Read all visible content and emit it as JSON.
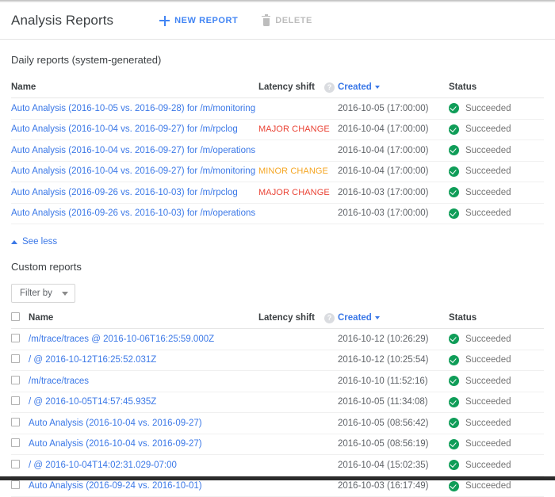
{
  "header": {
    "title": "Analysis Reports",
    "new_report_label": "NEW REPORT",
    "delete_label": "DELETE"
  },
  "daily": {
    "section_title": "Daily reports (system-generated)",
    "columns": {
      "name": "Name",
      "latency_shift": "Latency shift",
      "created": "Created",
      "status": "Status",
      "help_glyph": "?"
    },
    "rows": [
      {
        "name": "Auto Analysis (2016-10-05 vs. 2016-09-28) for /m/monitoring",
        "latency": "",
        "latency_level": "",
        "created": "2016-10-05 (17:00:00)",
        "status": "Succeeded"
      },
      {
        "name": "Auto Analysis (2016-10-04 vs. 2016-09-27) for /m/rpclog",
        "latency": "MAJOR CHANGE",
        "latency_level": "major",
        "created": "2016-10-04 (17:00:00)",
        "status": "Succeeded"
      },
      {
        "name": "Auto Analysis (2016-10-04 vs. 2016-09-27) for /m/operations",
        "latency": "",
        "latency_level": "",
        "created": "2016-10-04 (17:00:00)",
        "status": "Succeeded"
      },
      {
        "name": "Auto Analysis (2016-10-04 vs. 2016-09-27) for /m/monitoring",
        "latency": "MINOR CHANGE",
        "latency_level": "minor",
        "created": "2016-10-04 (17:00:00)",
        "status": "Succeeded"
      },
      {
        "name": "Auto Analysis (2016-09-26 vs. 2016-10-03) for /m/rpclog",
        "latency": "MAJOR CHANGE",
        "latency_level": "major",
        "created": "2016-10-03 (17:00:00)",
        "status": "Succeeded"
      },
      {
        "name": "Auto Analysis (2016-09-26 vs. 2016-10-03) for /m/operations",
        "latency": "",
        "latency_level": "",
        "created": "2016-10-03 (17:00:00)",
        "status": "Succeeded"
      }
    ],
    "see_less_label": "See less"
  },
  "custom": {
    "section_title": "Custom reports",
    "filter_label": "Filter by",
    "columns": {
      "name": "Name",
      "latency_shift": "Latency shift",
      "created": "Created",
      "status": "Status",
      "help_glyph": "?"
    },
    "rows": [
      {
        "name": "/m/trace/traces @ 2016-10-06T16:25:59.000Z",
        "latency": "",
        "latency_level": "",
        "created": "2016-10-12 (10:26:29)",
        "status": "Succeeded"
      },
      {
        "name": "/ @ 2016-10-12T16:25:52.031Z",
        "latency": "",
        "latency_level": "",
        "created": "2016-10-12 (10:25:54)",
        "status": "Succeeded"
      },
      {
        "name": "/m/trace/traces",
        "latency": "",
        "latency_level": "",
        "created": "2016-10-10 (11:52:16)",
        "status": "Succeeded"
      },
      {
        "name": "/ @ 2016-10-05T14:57:45.935Z",
        "latency": "",
        "latency_level": "",
        "created": "2016-10-05 (11:34:08)",
        "status": "Succeeded"
      },
      {
        "name": "Auto Analysis (2016-10-04 vs. 2016-09-27)",
        "latency": "",
        "latency_level": "",
        "created": "2016-10-05 (08:56:42)",
        "status": "Succeeded"
      },
      {
        "name": "Auto Analysis (2016-10-04 vs. 2016-09-27)",
        "latency": "",
        "latency_level": "",
        "created": "2016-10-05 (08:56:19)",
        "status": "Succeeded"
      },
      {
        "name": "/ @ 2016-10-04T14:02:31.029-07:00",
        "latency": "",
        "latency_level": "",
        "created": "2016-10-04 (15:02:35)",
        "status": "Succeeded"
      },
      {
        "name": "Auto Analysis (2016-09-24 vs. 2016-10-01)",
        "latency": "",
        "latency_level": "",
        "created": "2016-10-03 (16:17:49)",
        "status": "Succeeded"
      }
    ]
  },
  "colors": {
    "link": "#3b78e7",
    "accent": "#4285f4",
    "major": "#ea4335",
    "minor": "#f5a623",
    "success": "#0f9d58"
  }
}
